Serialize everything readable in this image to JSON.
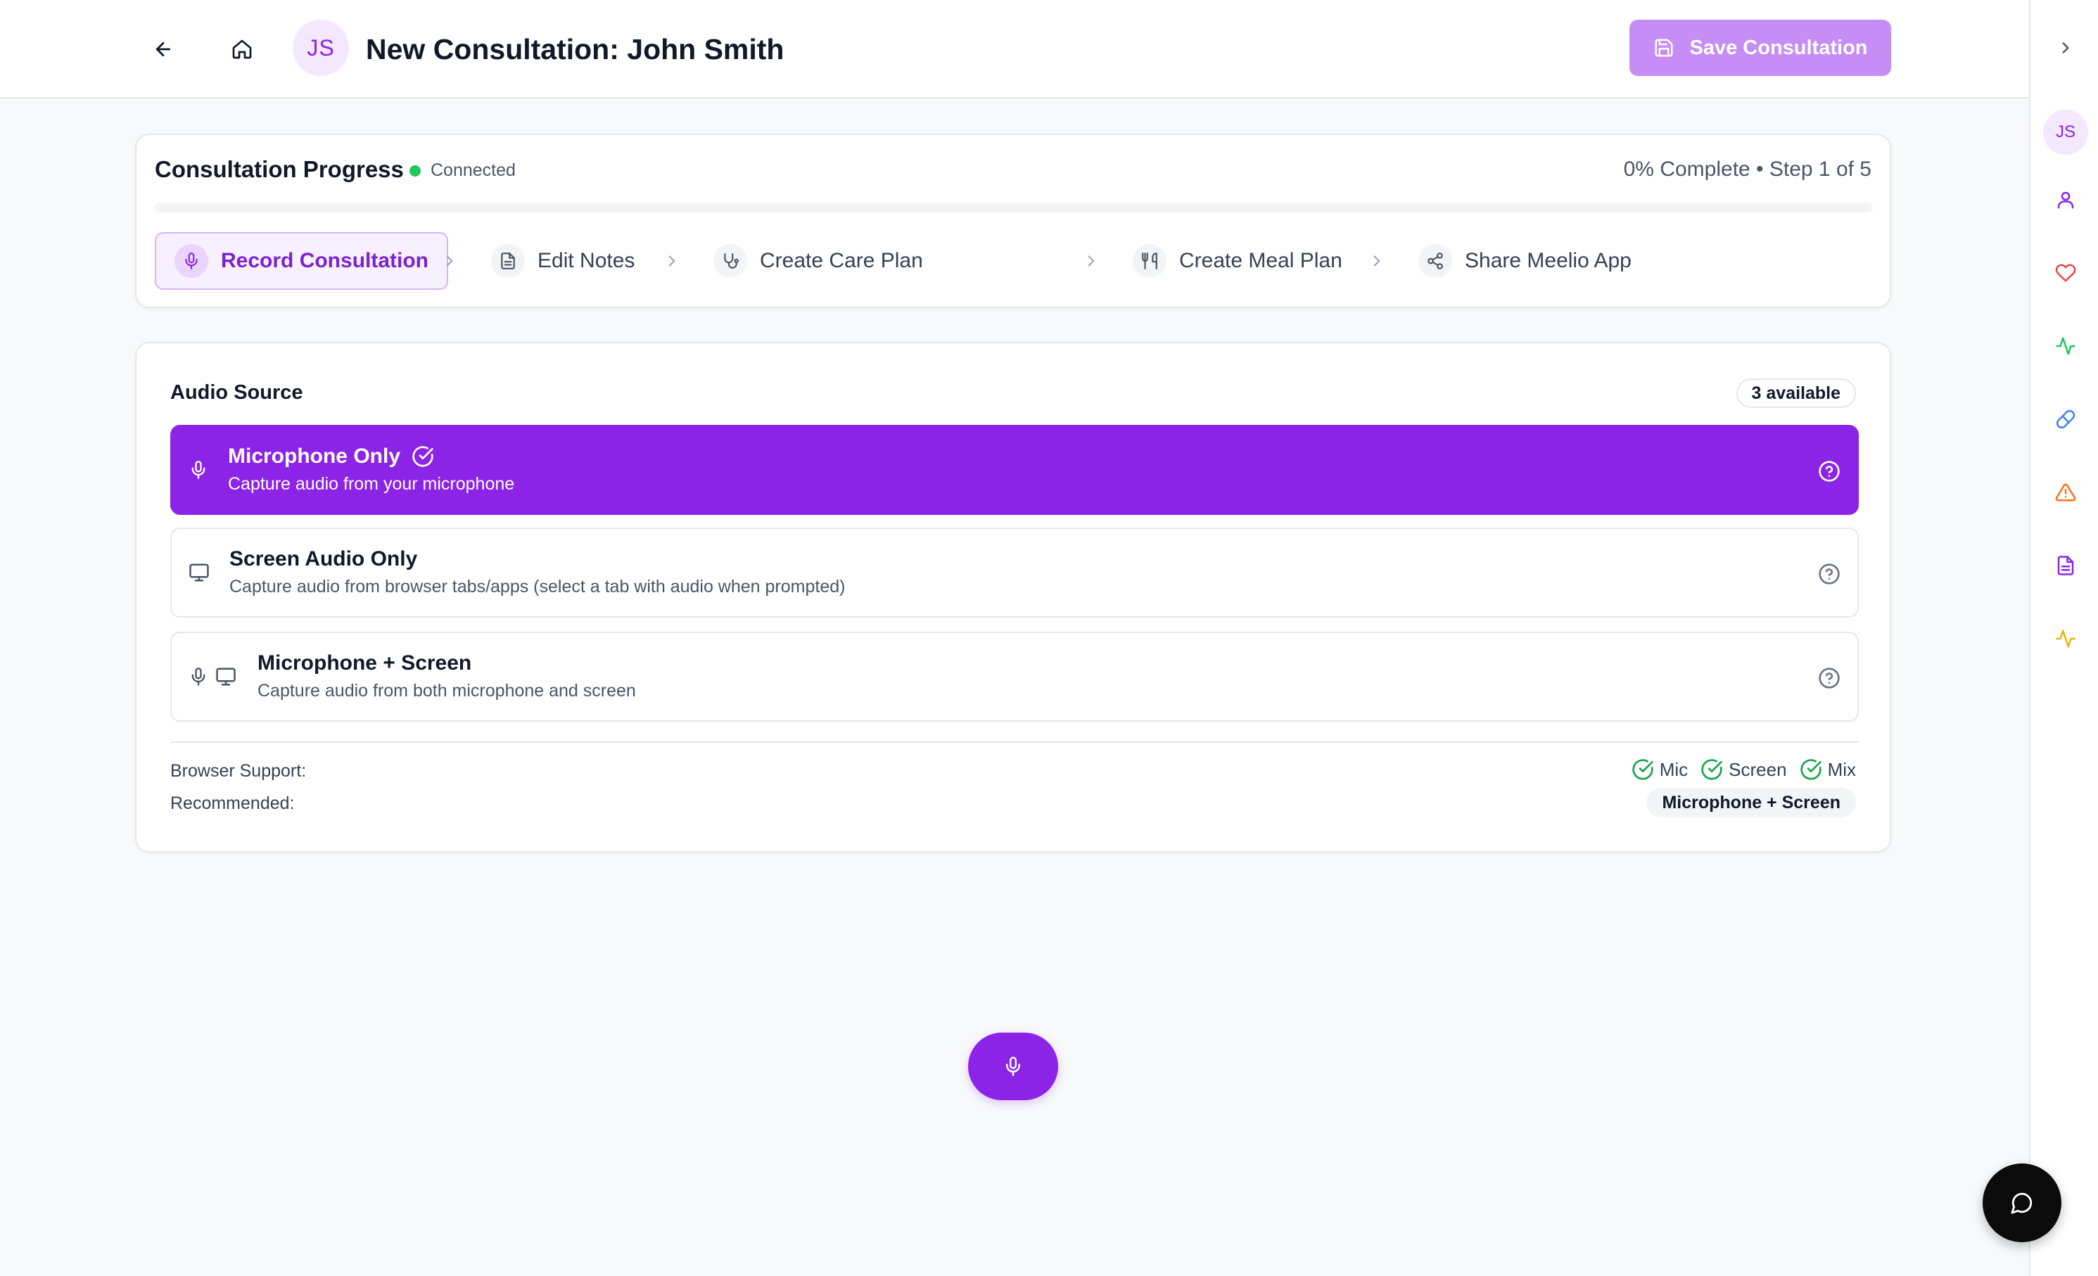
{
  "header": {
    "avatar_initials": "JS",
    "title": "New Consultation: John Smith",
    "save_label": "Save Consultation"
  },
  "progress": {
    "title": "Consultation Progress",
    "connection_status": "Connected",
    "status_text": "0% Complete • Step 1 of 5",
    "percent_complete": 0,
    "steps": [
      {
        "label": "Record Consultation",
        "icon": "microphone-icon",
        "active": true
      },
      {
        "label": "Edit Notes",
        "icon": "document-icon",
        "active": false
      },
      {
        "label": "Create Care Plan",
        "icon": "stethoscope-icon",
        "active": false
      },
      {
        "label": "Create Meal Plan",
        "icon": "utensils-icon",
        "active": false
      },
      {
        "label": "Share Meelio App",
        "icon": "share-icon",
        "active": false
      }
    ]
  },
  "audio_source": {
    "title": "Audio Source",
    "available_badge": "3 available",
    "options": [
      {
        "title": "Microphone Only",
        "description": "Capture audio from your microphone",
        "selected": true
      },
      {
        "title": "Screen Audio Only",
        "description": "Capture audio from browser tabs/apps (select a tab with audio when prompted)",
        "selected": false
      },
      {
        "title": "Microphone + Screen",
        "description": "Capture audio from both microphone and screen",
        "selected": false
      }
    ],
    "browser_support_label": "Browser Support:",
    "support_items": [
      "Mic",
      "Screen",
      "Mix"
    ],
    "recommended_label": "Recommended:",
    "recommended_value": "Microphone + Screen"
  },
  "sidebar": {
    "avatar_initials": "JS",
    "items": [
      {
        "icon": "user-icon",
        "color": "#8b24e6"
      },
      {
        "icon": "heart-icon",
        "color": "#ef4444"
      },
      {
        "icon": "activity-icon",
        "color": "#22c55e"
      },
      {
        "icon": "pill-icon",
        "color": "#3b82f6"
      },
      {
        "icon": "warning-icon",
        "color": "#f97316"
      },
      {
        "icon": "document-icon",
        "color": "#8b24e6"
      },
      {
        "icon": "activity-icon",
        "color": "#eab308"
      }
    ]
  },
  "colors": {
    "accent": "#8b24e6",
    "accent_light": "#c58df5",
    "success": "#22c55e"
  }
}
